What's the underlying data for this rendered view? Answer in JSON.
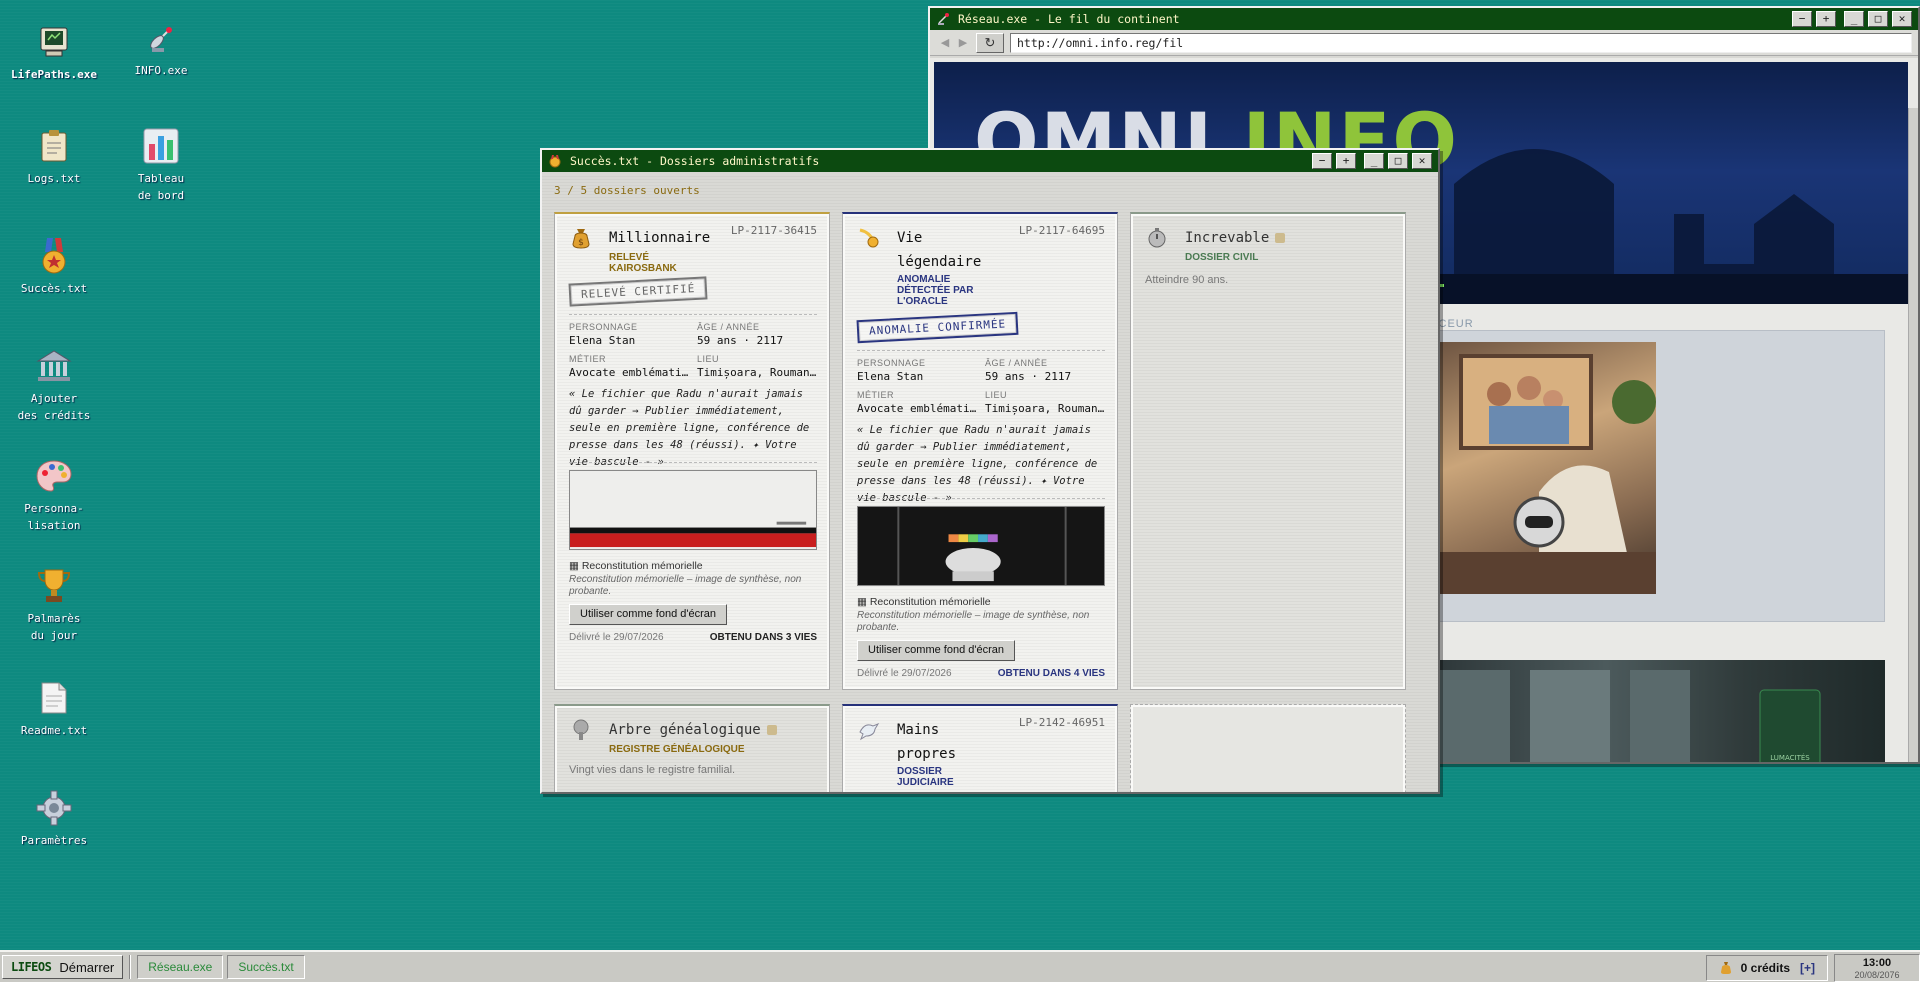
{
  "desktop": {
    "icons": [
      {
        "label": "LifePaths.exe",
        "icon": "computer-icon"
      },
      {
        "label": "INFO.exe",
        "icon": "satellite-icon"
      },
      {
        "label": "Logs.txt",
        "icon": "clipboard-icon"
      },
      {
        "label": "Tableau\nde bord",
        "icon": "bar-chart-icon"
      },
      {
        "label": "Succès.txt",
        "icon": "medal-icon"
      },
      {
        "label": "Ajouter\ndes crédits",
        "icon": "bank-icon"
      },
      {
        "label": "Personna-\nlisation",
        "icon": "palette-icon"
      },
      {
        "label": "Palmarès\ndu jour",
        "icon": "trophy-icon"
      },
      {
        "label": "Readme.txt",
        "icon": "document-icon"
      },
      {
        "label": "Paramètres",
        "icon": "gear-icon"
      }
    ]
  },
  "browser": {
    "title": "Réseau.exe - Le fil du continent",
    "url": "http://omni.info.reg/fil",
    "hero_logo_a": "OMNI",
    "hero_logo_b": "INFO",
    "section_label": "ONCEUR",
    "ad_sign": "LUMACITÉS"
  },
  "succes": {
    "title": "Succès.txt - Dossiers administratifs",
    "count": "3 / 5 dossiers ouverts",
    "cards": [
      {
        "title": "Millionnaire",
        "code": "LP-2117-36415",
        "sub": "RELEVÉ KAIROSBANK",
        "stamp": "RELEVÉ CERTIFIÉ",
        "labels": {
          "character": "PERSONNAGE",
          "age": "ÂGE / ANNÉE",
          "job": "MÉTIER",
          "place": "LIEU"
        },
        "character": "Elena Stan",
        "age": "59 ans · 2117",
        "job": "Avocate emblémati…",
        "place": "Timișoara, Rouman…",
        "quote": "« Le fichier que Radu n'aurait jamais dû garder → Publier immédiatement, seule en première ligne, conférence de presse dans les 48 (réussi). ✦ Votre vie bascule - »",
        "recon_title": "Reconstitution mémorielle",
        "recon_note": "Reconstitution mémorielle – image de synthèse, non probante.",
        "button": "Utiliser comme fond d'écran",
        "delivered": "Délivré le 29/07/2026",
        "obtained": "OBTENU DANS 3 VIES"
      },
      {
        "title": "Vie\nlégendaire",
        "code": "LP-2117-64695",
        "sub": "ANOMALIE DÉTECTÉE PAR L'ORACLE",
        "stamp": "ANOMALIE CONFIRMÉE",
        "labels": {
          "character": "PERSONNAGE",
          "age": "ÂGE / ANNÉE",
          "job": "MÉTIER",
          "place": "LIEU"
        },
        "character": "Elena Stan",
        "age": "59 ans · 2117",
        "job": "Avocate emblémati…",
        "place": "Timișoara, Rouman…",
        "quote": "« Le fichier que Radu n'aurait jamais dû garder → Publier immédiatement, seule en première ligne, conférence de presse dans les 48 (réussi). ✦ Votre vie bascule - »",
        "recon_title": "Reconstitution mémorielle",
        "recon_note": "Reconstitution mémorielle – image de synthèse, non probante.",
        "button": "Utiliser comme fond d'écran",
        "delivered": "Délivré le 29/07/2026",
        "obtained": "OBTENU DANS 4 VIES"
      },
      {
        "title": "Increvable",
        "sub": "DOSSIER CIVIL",
        "desc": "Atteindre 90 ans."
      },
      {
        "title": "Arbre généalogique",
        "sub": "REGISTRE GÉNÉALOGIQUE",
        "desc": "Vingt vies dans le registre familial."
      },
      {
        "title": "Mains\npropres",
        "code": "LP-2142-46951",
        "sub": "DOSSIER JUDICIAIRE"
      }
    ]
  },
  "taskbar": {
    "logo": "LIFEOS",
    "start": "Démarrer",
    "tasks": [
      "Réseau.exe",
      "Succès.txt"
    ],
    "credits": "0 crédits",
    "add": "[+]",
    "time": "13:00",
    "date": "20/08/2076"
  }
}
